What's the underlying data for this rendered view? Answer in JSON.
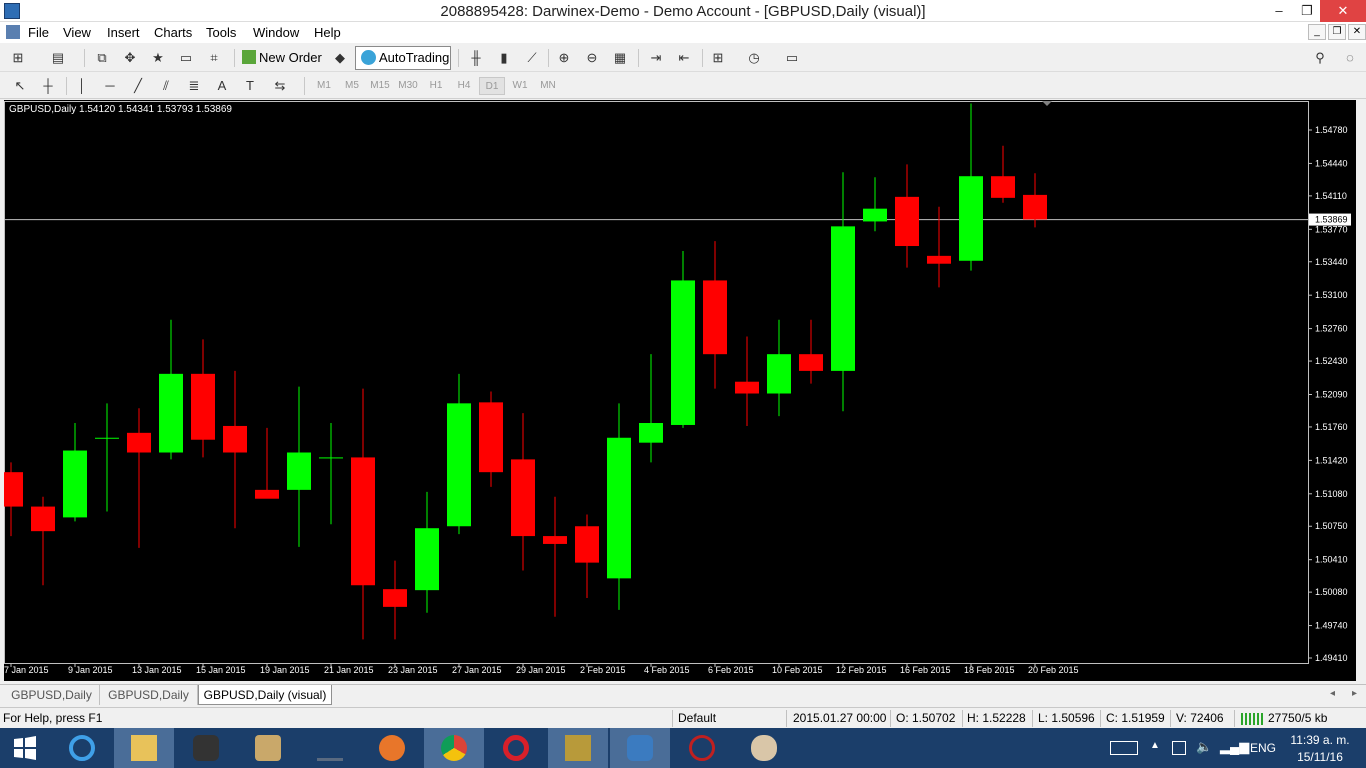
{
  "window": {
    "title": "2088895428: Darwinex-Demo - Demo Account - [GBPUSD,Daily (visual)]",
    "minimize": "‒",
    "maximize": "❐",
    "close": "✕"
  },
  "menu": [
    "File",
    "View",
    "Insert",
    "Charts",
    "Tools",
    "Window",
    "Help"
  ],
  "toolbar": {
    "new_order": "New Order",
    "autotrading": "AutoTrading"
  },
  "timeframes": [
    "M1",
    "M5",
    "M15",
    "M30",
    "H1",
    "H4",
    "D1",
    "W1",
    "MN"
  ],
  "active_timeframe": "D1",
  "chart": {
    "header": "GBPUSD,Daily  1.54120 1.54341 1.53793 1.53869",
    "current_price": "1.53869",
    "price_ticks": [
      "1.54780",
      "1.54440",
      "1.54110",
      "1.53770",
      "1.53440",
      "1.53100",
      "1.52760",
      "1.52430",
      "1.52090",
      "1.51760",
      "1.51420",
      "1.51080",
      "1.50750",
      "1.50410",
      "1.50080",
      "1.49740",
      "1.49410"
    ],
    "date_ticks": [
      "7 Jan 2015",
      "9 Jan 2015",
      "13 Jan 2015",
      "15 Jan 2015",
      "19 Jan 2015",
      "21 Jan 2015",
      "23 Jan 2015",
      "27 Jan 2015",
      "29 Jan 2015",
      "2 Feb 2015",
      "4 Feb 2015",
      "6 Feb 2015",
      "10 Feb 2015",
      "12 Feb 2015",
      "16 Feb 2015",
      "18 Feb 2015",
      "20 Feb 2015"
    ],
    "colors": {
      "bull": "#00ff00",
      "bear": "#ff0000",
      "background": "#000000",
      "text": "#ffffff"
    }
  },
  "chart_data": {
    "type": "candlestick",
    "symbol": "GBPUSD",
    "timeframe": "Daily",
    "ylim": [
      1.4941,
      1.4978
    ],
    "candles": [
      {
        "o": 1.513,
        "h": 1.514,
        "l": 1.5065,
        "c": 1.5095
      },
      {
        "o": 1.5095,
        "h": 1.5105,
        "l": 1.5015,
        "c": 1.507
      },
      {
        "o": 1.5084,
        "h": 1.518,
        "l": 1.508,
        "c": 1.5152
      },
      {
        "o": 1.5165,
        "h": 1.52,
        "l": 1.509,
        "c": 1.5165
      },
      {
        "o": 1.517,
        "h": 1.5195,
        "l": 1.5053,
        "c": 1.515
      },
      {
        "o": 1.515,
        "h": 1.5285,
        "l": 1.5143,
        "c": 1.523
      },
      {
        "o": 1.523,
        "h": 1.5265,
        "l": 1.5145,
        "c": 1.5163
      },
      {
        "o": 1.5177,
        "h": 1.5233,
        "l": 1.5073,
        "c": 1.515
      },
      {
        "o": 1.5112,
        "h": 1.5175,
        "l": 1.5105,
        "c": 1.5103
      },
      {
        "o": 1.5112,
        "h": 1.5217,
        "l": 1.5054,
        "c": 1.515
      },
      {
        "o": 1.5145,
        "h": 1.518,
        "l": 1.5077,
        "c": 1.5145
      },
      {
        "o": 1.5145,
        "h": 1.5215,
        "l": 1.496,
        "c": 1.5015
      },
      {
        "o": 1.5011,
        "h": 1.504,
        "l": 1.496,
        "c": 1.4993
      },
      {
        "o": 1.501,
        "h": 1.511,
        "l": 1.4987,
        "c": 1.5073
      },
      {
        "o": 1.5075,
        "h": 1.523,
        "l": 1.5067,
        "c": 1.52
      },
      {
        "o": 1.5201,
        "h": 1.5212,
        "l": 1.5115,
        "c": 1.513
      },
      {
        "o": 1.5143,
        "h": 1.519,
        "l": 1.503,
        "c": 1.5065
      },
      {
        "o": 1.5065,
        "h": 1.5105,
        "l": 1.4983,
        "c": 1.5057
      },
      {
        "o": 1.5075,
        "h": 1.5087,
        "l": 1.5002,
        "c": 1.5038
      },
      {
        "o": 1.5022,
        "h": 1.52,
        "l": 1.499,
        "c": 1.5165
      },
      {
        "o": 1.516,
        "h": 1.525,
        "l": 1.514,
        "c": 1.518
      },
      {
        "o": 1.5178,
        "h": 1.5355,
        "l": 1.5175,
        "c": 1.5325
      },
      {
        "o": 1.5325,
        "h": 1.5365,
        "l": 1.5215,
        "c": 1.525
      },
      {
        "o": 1.5222,
        "h": 1.5268,
        "l": 1.5177,
        "c": 1.521
      },
      {
        "o": 1.521,
        "h": 1.5285,
        "l": 1.5187,
        "c": 1.525
      },
      {
        "o": 1.525,
        "h": 1.5285,
        "l": 1.522,
        "c": 1.5233
      },
      {
        "o": 1.5233,
        "h": 1.5435,
        "l": 1.5192,
        "c": 1.538
      },
      {
        "o": 1.5385,
        "h": 1.543,
        "l": 1.5375,
        "c": 1.5398
      },
      {
        "o": 1.541,
        "h": 1.5443,
        "l": 1.5338,
        "c": 1.536
      },
      {
        "o": 1.535,
        "h": 1.54,
        "l": 1.5318,
        "c": 1.5342
      },
      {
        "o": 1.5345,
        "h": 1.5505,
        "l": 1.5335,
        "c": 1.5431
      },
      {
        "o": 1.5431,
        "h": 1.5462,
        "l": 1.5404,
        "c": 1.5409
      },
      {
        "o": 1.5412,
        "h": 1.5434,
        "l": 1.5379,
        "c": 1.5387
      }
    ]
  },
  "symbol_tabs": [
    "GBPUSD,Daily",
    "GBPUSD,Daily",
    "GBPUSD,Daily (visual)"
  ],
  "status": {
    "help": "For Help, press F1",
    "profile": "Default",
    "datetime": "2015.01.27 00:00",
    "open": "O: 1.50702",
    "high": "H: 1.52228",
    "low": "L: 1.50596",
    "close": "C: 1.51959",
    "volume": "V: 72406",
    "traffic": "27750/5 kb"
  },
  "taskbar": {
    "lang": "ENG",
    "time": "11:39 a. m.",
    "date": "15/11/16"
  }
}
